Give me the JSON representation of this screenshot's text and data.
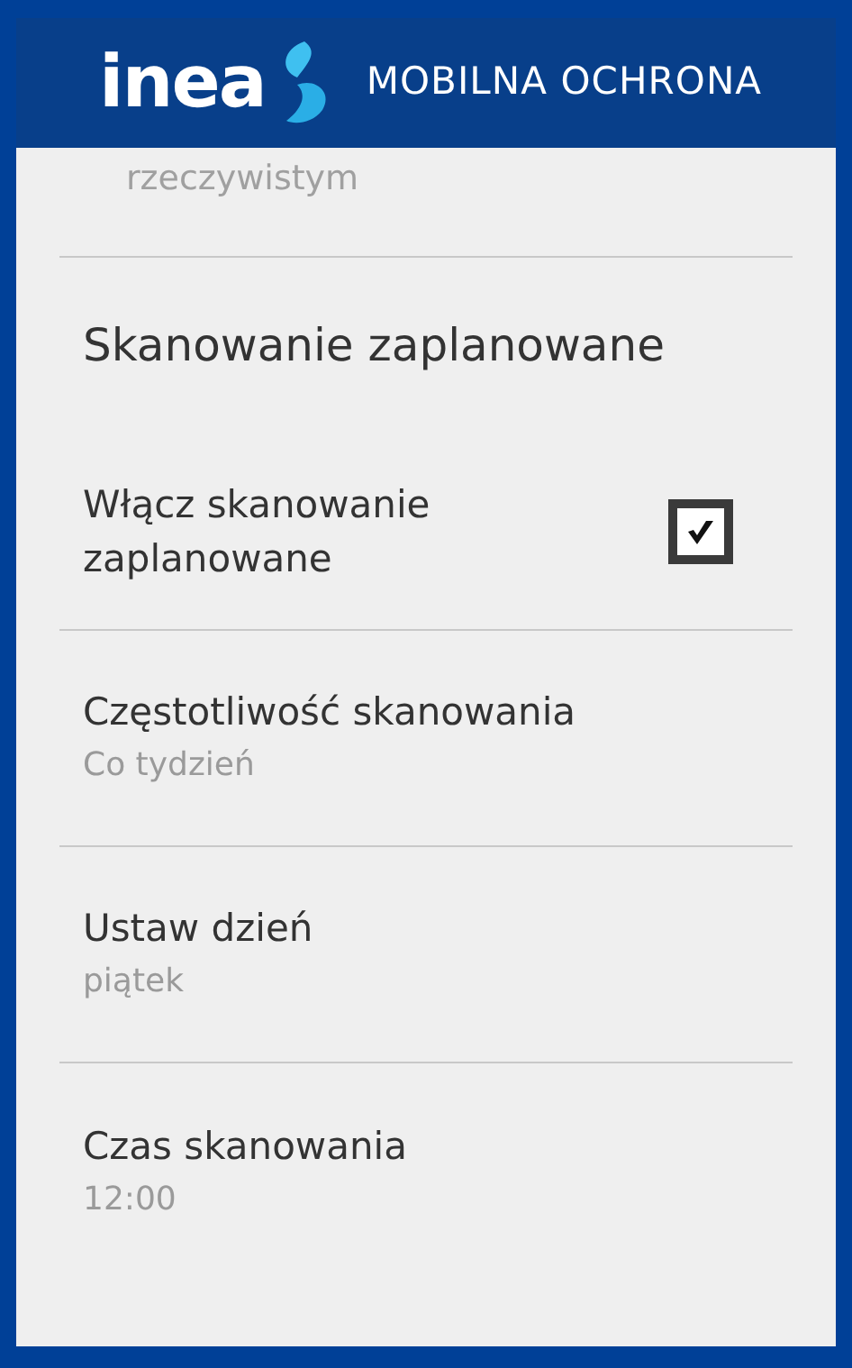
{
  "header": {
    "logo": "inea",
    "title": "MOBILNA OCHRONA"
  },
  "cut_summary": "rzeczywistym",
  "section_title": "Skanowanie zaplanowane",
  "items": [
    {
      "kind": "checkbox",
      "title": "Włącz skanowanie zaplanowane",
      "checked": true
    },
    {
      "kind": "value",
      "title": "Częstotliwość skanowania",
      "summary": "Co tydzień"
    },
    {
      "kind": "value",
      "title": "Ustaw dzień",
      "summary": "piątek"
    },
    {
      "kind": "value",
      "title": "Czas skanowania",
      "summary": "12:00"
    }
  ]
}
